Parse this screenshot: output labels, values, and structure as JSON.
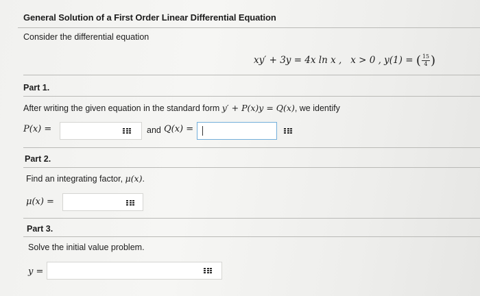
{
  "title": "General Solution of a First Order Linear Differential Equation",
  "intro": "Consider the differential equation",
  "equation": {
    "lhs": "xy′ + 3y = 4x ln x ,",
    "condition": "x > 0 , y(1) =",
    "frac_num": "15",
    "frac_den": "4"
  },
  "part1": {
    "heading": "Part 1.",
    "prompt_prefix": "After writing the given equation in the standard form ",
    "prompt_form": "y′ + P(x)y = Q(x)",
    "prompt_suffix": ", we identify",
    "p_label": "P(x) =",
    "and_text": "and",
    "q_label": "Q(x) =",
    "p_value": "",
    "q_value": ""
  },
  "part2": {
    "heading": "Part 2.",
    "prompt_prefix": "Find an integrating factor, ",
    "prompt_math": "μ(x)",
    "prompt_suffix": ".",
    "mu_label": "μ(x) =",
    "mu_value": ""
  },
  "part3": {
    "heading": "Part 3.",
    "prompt": "Solve the initial value problem.",
    "y_label": "y =",
    "y_value": ""
  },
  "icons": {
    "matrix": "matrix-grid-icon"
  }
}
